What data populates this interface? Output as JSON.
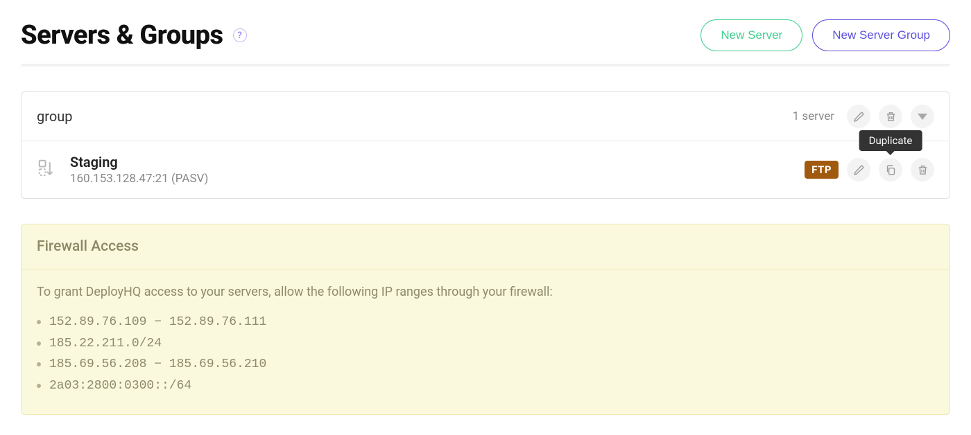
{
  "header": {
    "title": "Servers & Groups",
    "new_server_label": "New Server",
    "new_group_label": "New Server Group"
  },
  "group": {
    "name": "group",
    "server_count_text": "1 server"
  },
  "server": {
    "name": "Staging",
    "host": "160.153.128.47:21 (PASV)",
    "protocol": "FTP"
  },
  "actions": {
    "duplicate_tooltip": "Duplicate"
  },
  "firewall": {
    "title": "Firewall Access",
    "intro": "To grant DeployHQ access to your servers, allow the following IP ranges through your firewall:",
    "ips": [
      "152.89.76.109 − 152.89.76.111",
      "185.22.211.0/24",
      "185.69.56.208 − 185.69.56.210",
      "2a03:2800:0300::/64"
    ]
  }
}
